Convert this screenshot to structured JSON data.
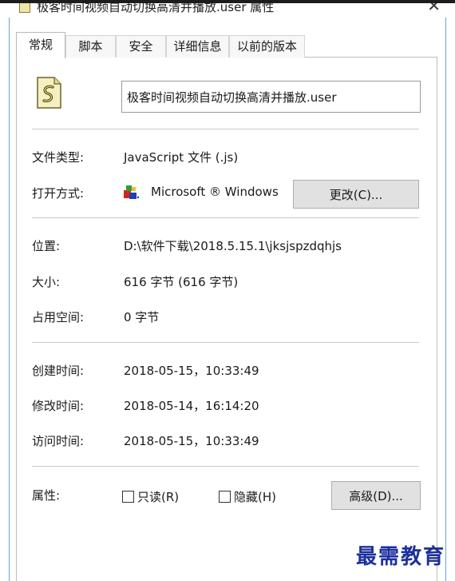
{
  "window": {
    "title": "极客时间视频自动切换高清并播放.user 属性",
    "close_glyph": "✕"
  },
  "tabs": [
    {
      "label": "常规",
      "active": true
    },
    {
      "label": "脚本"
    },
    {
      "label": "安全"
    },
    {
      "label": "详细信息"
    },
    {
      "label": "以前的版本"
    }
  ],
  "general": {
    "file_name": "极客时间视频自动切换高清并播放.user",
    "file_type_label": "文件类型:",
    "file_type_value": "JavaScript 文件 (.js)",
    "open_with_label": "打开方式:",
    "open_with_value": "Microsoft ® Windows",
    "change_button": "更改(C)...",
    "location_label": "位置:",
    "location_value": "D:\\软件下载\\2018.5.15.1\\jksjspzdqhjs",
    "size_label": "大小:",
    "size_value": "616 字节 (616 字节)",
    "size_on_disk_label": "占用空间:",
    "size_on_disk_value": "0 字节",
    "created_label": "创建时间:",
    "created_value": "2018-05-15，10:33:49",
    "modified_label": "修改时间:",
    "modified_value": "2018-05-14，16:14:20",
    "accessed_label": "访问时间:",
    "accessed_value": "2018-05-15，10:33:49",
    "attributes_label": "属性:",
    "readonly_label": "只读(R)",
    "hidden_label": "隐藏(H)",
    "advanced_button": "高级(D)..."
  },
  "watermark": "最需教育",
  "colors": {
    "frame_accent": "#6aa6d6",
    "watermark": "#1c2f9e",
    "button_face": "#e1e1e1"
  },
  "icons": {
    "file": "script-file-icon",
    "open_with": "windows-script-host-icon",
    "close": "close-icon"
  }
}
